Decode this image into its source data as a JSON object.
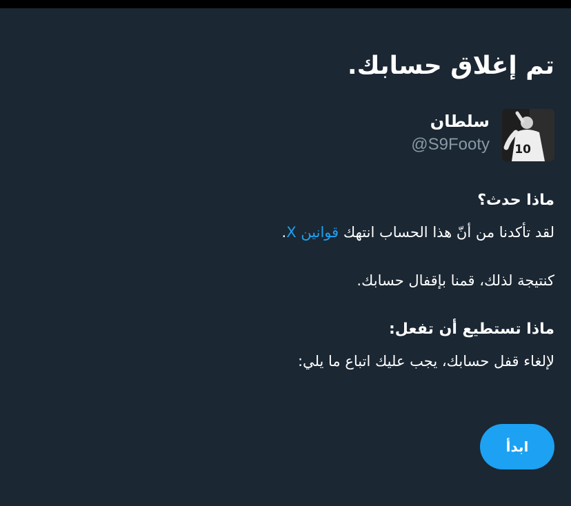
{
  "page": {
    "title": "تم إغلاق حسابك."
  },
  "account": {
    "name": "سلطان",
    "handle": "@S9Footy",
    "avatar_jersey_number": "10"
  },
  "sections": {
    "what_happened": {
      "heading": "ماذا حدث؟",
      "text_before_link": "لقد تأكدنا من أنّ هذا الحساب انتهك ",
      "link_label": "قوانين X",
      "text_after_link": ".",
      "consequence": "كنتيجة لذلك، قمنا بإقفال حسابك."
    },
    "what_you_can_do": {
      "heading": "ماذا تستطيع أن تفعل:",
      "text": "لإلغاء قفل حسابك، يجب عليك اتباع ما يلي:"
    }
  },
  "actions": {
    "start_label": "ابدأ"
  },
  "colors": {
    "background": "#1b2733",
    "accent": "#1da1f2",
    "secondary_text": "#8899a6",
    "top_bar": "#000000"
  }
}
